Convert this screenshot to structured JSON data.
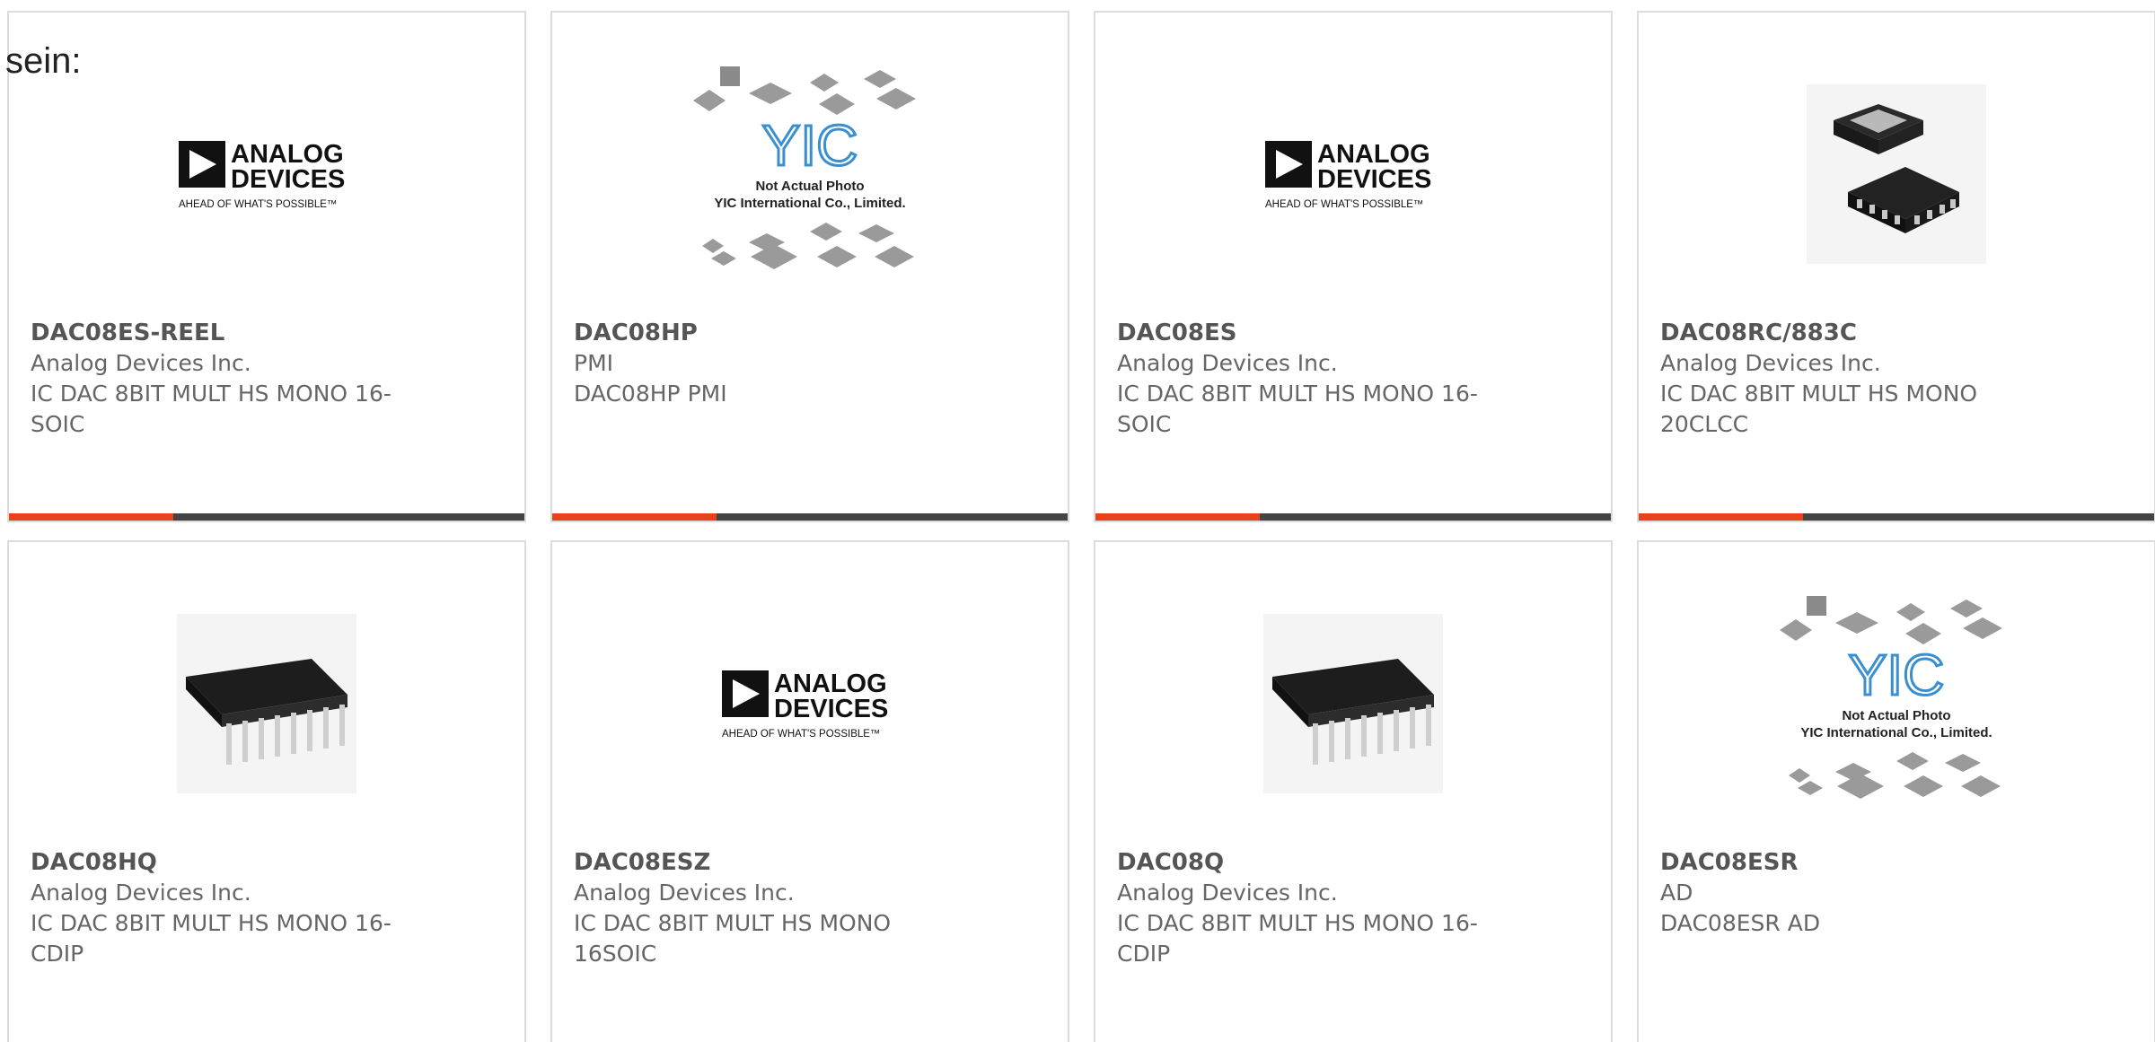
{
  "prefix": "sein:",
  "cards": [
    {
      "pn": "DAC08ES-REEL",
      "mfr": "Analog Devices Inc.",
      "desc": "IC DAC 8BIT MULT HS MONO 16-SOIC",
      "image": "adi-logo"
    },
    {
      "pn": "DAC08HP",
      "mfr": "PMI",
      "desc": "DAC08HP PMI",
      "image": "yic-placeholder"
    },
    {
      "pn": "DAC08ES",
      "mfr": "Analog Devices Inc.",
      "desc": "IC DAC 8BIT MULT HS MONO 16-SOIC",
      "image": "adi-logo"
    },
    {
      "pn": "DAC08RC/883C",
      "mfr": "Analog Devices Inc.",
      "desc": "IC DAC 8BIT MULT HS MONO 20CLCC",
      "image": "clcc-chip"
    },
    {
      "pn": "DAC08HQ",
      "mfr": "Analog Devices Inc.",
      "desc": "IC DAC 8BIT MULT HS MONO 16-CDIP",
      "image": "dip-chip"
    },
    {
      "pn": "DAC08ESZ",
      "mfr": "Analog Devices Inc.",
      "desc": "IC DAC 8BIT MULT HS MONO 16SOIC",
      "image": "adi-logo"
    },
    {
      "pn": "DAC08Q",
      "mfr": "Analog Devices Inc.",
      "desc": "IC DAC 8BIT MULT HS MONO 16-CDIP",
      "image": "dip-chip"
    },
    {
      "pn": "DAC08ESR",
      "mfr": "AD",
      "desc": "DAC08ESR AD",
      "image": "yic-placeholder"
    }
  ],
  "logo": {
    "adi_line1": "ANALOG",
    "adi_line2": "DEVICES",
    "adi_tagline": "AHEAD OF WHAT'S POSSIBLE™",
    "yic_mark": "YIC",
    "yic_line1": "Not Actual Photo",
    "yic_line2": "YIC International Co., Limited."
  },
  "colors": {
    "accent": "#e8411c",
    "bar_dark": "#444444",
    "border": "#dcdcdc"
  }
}
